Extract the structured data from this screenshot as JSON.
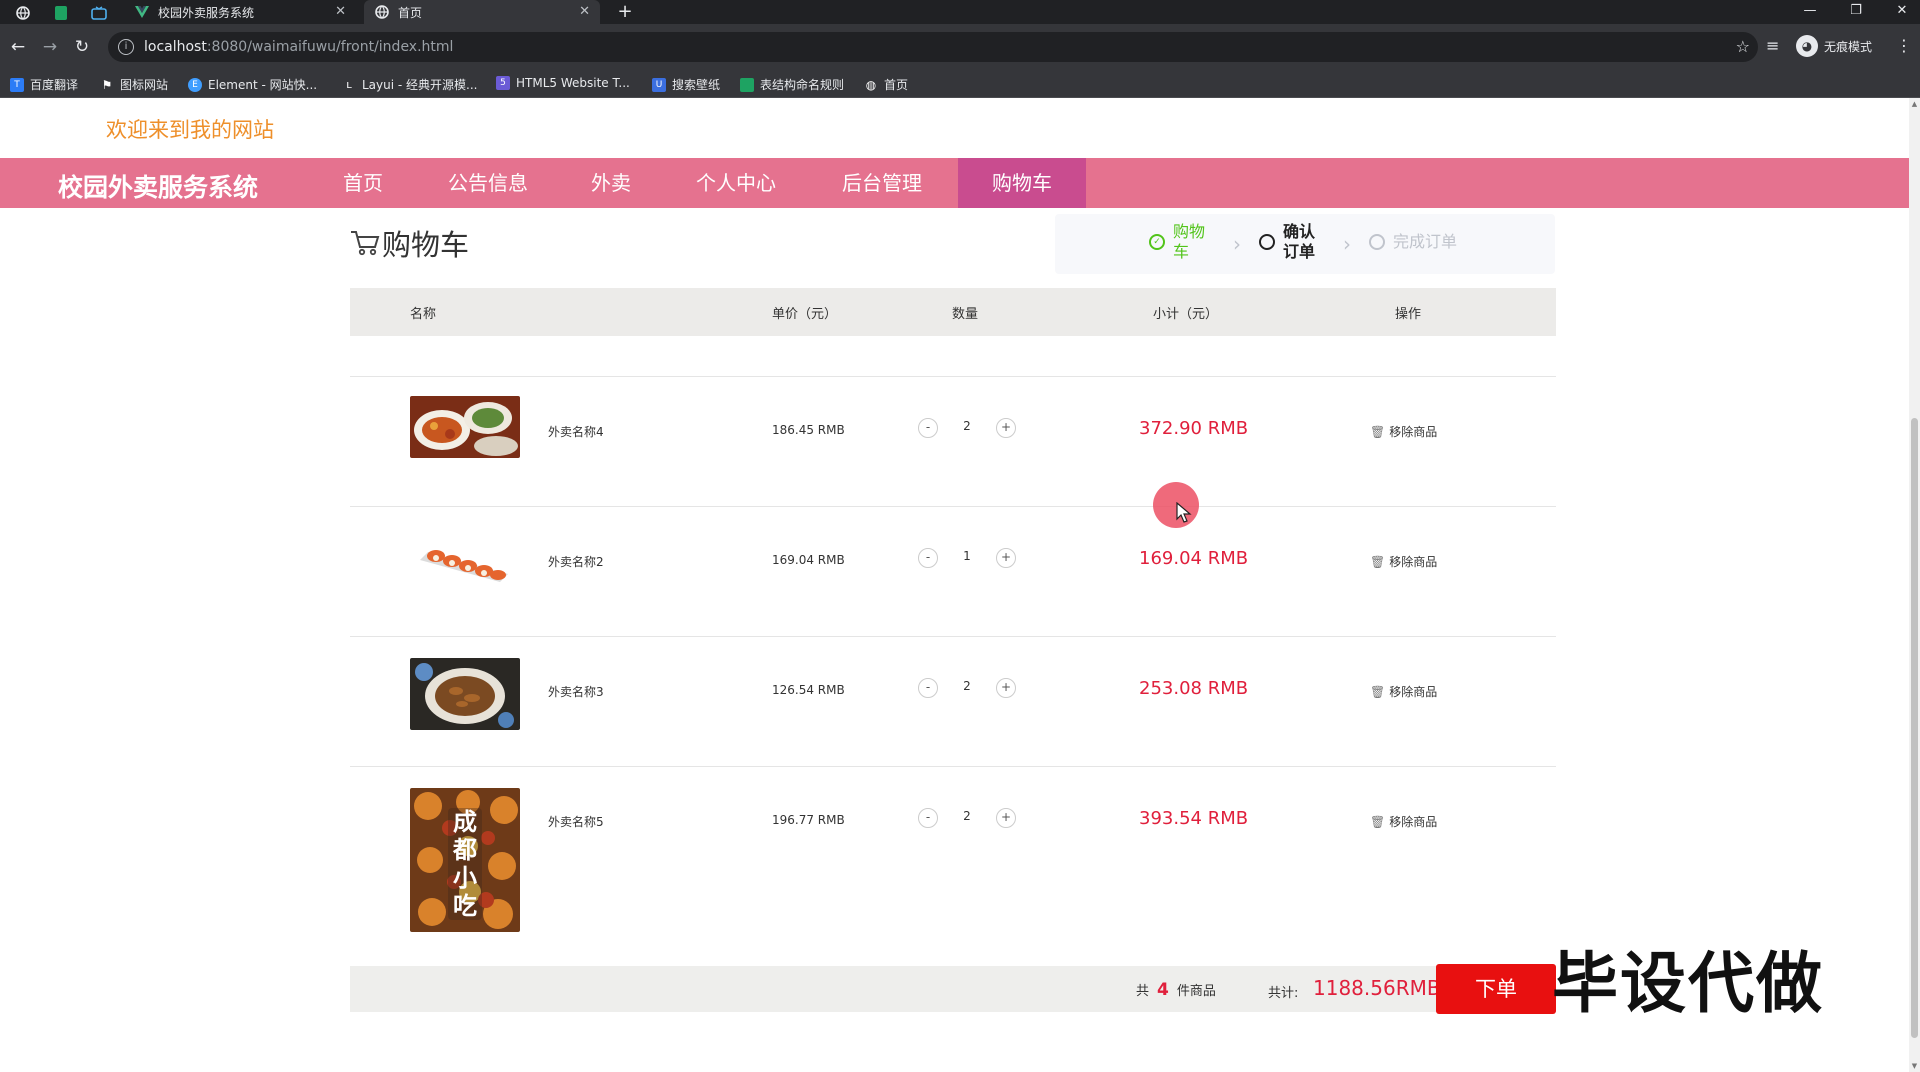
{
  "browser": {
    "tabs": [
      {
        "title": "校园外卖服务系统",
        "active": false
      },
      {
        "title": "首页",
        "active": true
      }
    ],
    "url": {
      "host": "localhost",
      "path": ":8080/waimaifuwu/front/index.html"
    },
    "profile_label": "无痕模式",
    "bookmarks": [
      {
        "label": "百度翻译",
        "icon": "translate-icon",
        "color": "#2c7cf6"
      },
      {
        "label": "图标网站",
        "icon": "flag-icon",
        "color": "#35363a"
      },
      {
        "label": "Element - 网站快...",
        "icon": "element-icon",
        "color": "#409eff"
      },
      {
        "label": "Layui - 经典开源模...",
        "icon": "layui-icon",
        "color": "#35363a"
      },
      {
        "label": "HTML5 Website T...",
        "icon": "html5-icon",
        "color": "#6b5bd6"
      },
      {
        "label": "搜索壁纸",
        "icon": "wallpaper-icon",
        "color": "#3b6fe0"
      },
      {
        "label": "表结构命名规则",
        "icon": "sheet-icon",
        "color": "#1ea362"
      },
      {
        "label": "首页",
        "icon": "globe-icon",
        "color": "#35363a"
      }
    ]
  },
  "page": {
    "welcome": "欢迎来到我的网站",
    "brand": "校园外卖服务系统",
    "nav": [
      {
        "label": "首页",
        "active": false
      },
      {
        "label": "公告信息",
        "active": false
      },
      {
        "label": "外卖",
        "active": false
      },
      {
        "label": "个人中心",
        "active": false
      },
      {
        "label": "后台管理",
        "active": false
      },
      {
        "label": "购物车",
        "active": true
      }
    ],
    "cart_title": "购物车",
    "steps": [
      {
        "label": "购物车",
        "state": "done"
      },
      {
        "label": "确认订单",
        "state": "current"
      },
      {
        "label": "完成订单",
        "state": "pending"
      }
    ],
    "table_headers": {
      "name": "名称",
      "unit_price": "单价（元）",
      "quantity": "数量",
      "subtotal": "小计（元）",
      "action": "操作"
    },
    "items": [
      {
        "name": "外卖名称4",
        "price": "186.45 RMB",
        "qty": "2",
        "subtotal": "372.90 RMB",
        "remove": "移除商品"
      },
      {
        "name": "外卖名称2",
        "price": "169.04 RMB",
        "qty": "1",
        "subtotal": "169.04 RMB",
        "remove": "移除商品"
      },
      {
        "name": "外卖名称3",
        "price": "126.54 RMB",
        "qty": "2",
        "subtotal": "253.08 RMB",
        "remove": "移除商品"
      },
      {
        "name": "外卖名称5",
        "price": "196.77 RMB",
        "qty": "2",
        "subtotal": "393.54 RMB",
        "remove": "移除商品"
      }
    ],
    "food_image_text": "成都小吃",
    "stepper": {
      "minus": "-",
      "plus": "+"
    },
    "summary": {
      "prefix": "共",
      "count": "4",
      "suffix": "件商品",
      "total_label": "共计:",
      "total": "1188.56RMB"
    },
    "order_button": "下单",
    "watermark": "毕设代做"
  },
  "colors": {
    "navbar": "#e5728f",
    "nav_active": "#c94c8f",
    "welcome": "#ee8f2a",
    "price_red": "#e0203c",
    "order_button": "#e81010",
    "step_done": "#52c41a"
  }
}
